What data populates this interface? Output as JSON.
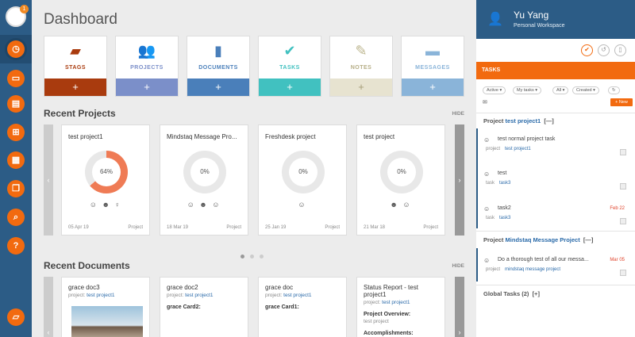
{
  "sidebar": {
    "badge": "1",
    "icons": [
      "logo-icon",
      "timer-icon",
      "chat-icon",
      "inbox-icon",
      "grid-icon",
      "calendar-icon",
      "messages-icon",
      "search-icon",
      "help-icon",
      "feedback-icon"
    ]
  },
  "main": {
    "title": "Dashboard",
    "tiles": [
      {
        "label": "STAGS",
        "color": "#a93b0e",
        "icon": "stags-icon",
        "glyph": "▰",
        "plus": "+"
      },
      {
        "label": "PROJECTS",
        "color": "#7b8fc9",
        "icon": "people-icon",
        "glyph": "👥",
        "plus": "+"
      },
      {
        "label": "DOCUMENTS",
        "color": "#4a7fba",
        "icon": "document-icon",
        "glyph": "▮",
        "plus": "+"
      },
      {
        "label": "TASKS",
        "color": "#41c1c0",
        "icon": "check-icon",
        "glyph": "✔",
        "plus": "+"
      },
      {
        "label": "NOTES",
        "color": "#e7e3d0",
        "icon": "pen-icon",
        "glyph": "✎",
        "plus": "+"
      },
      {
        "label": "MESSAGES",
        "color": "#8ab4d9",
        "icon": "message-icon",
        "glyph": "▬",
        "plus": "+"
      }
    ],
    "recent_projects": {
      "title": "Recent Projects",
      "hide": "HIDE",
      "cards": [
        {
          "title": "test project1",
          "percent": 64,
          "label": "64%",
          "date": "05 Apr 19",
          "kind": "Project",
          "avatars": "☺ ☻ ♀"
        },
        {
          "title": "Mindstaq Message Pro...",
          "percent": 0,
          "label": "0%",
          "date": "18 Mar 19",
          "kind": "Project",
          "avatars": "☺ ☻ ☺"
        },
        {
          "title": "Freshdesk project",
          "percent": 0,
          "label": "0%",
          "date": "25 Jan 19",
          "kind": "Project",
          "avatars": "☺"
        },
        {
          "title": "test project",
          "percent": 0,
          "label": "0%",
          "date": "21 Mar 18",
          "kind": "Project",
          "avatars": "☻ ☺"
        }
      ]
    },
    "recent_documents": {
      "title": "Recent Documents",
      "hide": "HIDE",
      "cards": [
        {
          "title": "grace doc3",
          "project_prefix": "project:",
          "project": "test project1",
          "content": ""
        },
        {
          "title": "grace doc2",
          "project_prefix": "project:",
          "project": "test project1",
          "content": "grace Card2:"
        },
        {
          "title": "grace doc",
          "project_prefix": "project:",
          "project": "test project1",
          "content": "grace Card1:"
        },
        {
          "title": "Status Report - test project1",
          "project_prefix": "project:",
          "project": "test project1",
          "content": "Project Overview:",
          "extra": "test project",
          "extra2": "Accomplishments:"
        }
      ]
    }
  },
  "right_panel": {
    "user_name": "Yu Yang",
    "workspace": "Personal Workspace",
    "header": "TASKS",
    "filters": [
      "Active ▾",
      "My tasks ▾",
      "All ▾",
      "Created ▾",
      "↻"
    ],
    "new_button": "+ New",
    "groups": [
      {
        "prefix": "Project",
        "name": "test project1",
        "toggle": "[—]",
        "tasks": [
          {
            "name": "test normal project task",
            "type": "project",
            "ref": "test project1",
            "date": ""
          },
          {
            "name": "test",
            "type": "task",
            "ref": "task3",
            "date": ""
          },
          {
            "name": "task2",
            "type": "task",
            "ref": "task3",
            "date": "Feb 22"
          }
        ]
      },
      {
        "prefix": "Project",
        "name": "Mindstaq Message Project",
        "toggle": "[—]",
        "tasks": [
          {
            "name": "Do a thorough test of all our messa...",
            "type": "project",
            "ref": "mindstaq message project",
            "date": "Mar 05"
          }
        ]
      }
    ],
    "global": "Global Tasks (2)",
    "global_toggle": "[+]"
  }
}
